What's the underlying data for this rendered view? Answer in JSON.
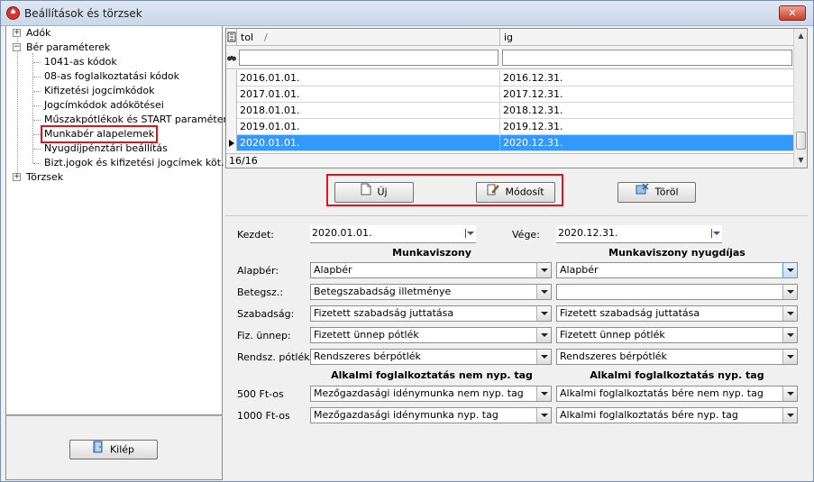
{
  "window": {
    "title": "Beállítások és törzsek",
    "close_label": "✕",
    "app_icon_glyph": "♠"
  },
  "tree": {
    "items": [
      {
        "label": "Adók",
        "toggle": "+"
      },
      {
        "label": "Bér paraméterek",
        "toggle": "−"
      },
      {
        "label": "1041-as kódok"
      },
      {
        "label": "08-as foglalkoztatási kódok"
      },
      {
        "label": "Kifizetési jogcímkódok"
      },
      {
        "label": "Jogcímkódok adókötései"
      },
      {
        "label": "Műszakpótlékok és START paraméterek"
      },
      {
        "label": "Munkabér alapelemek"
      },
      {
        "label": "Nyugdíjpénztári beállítás"
      },
      {
        "label": "Bizt.jogok és kifizetési jogcímek köt."
      },
      {
        "label": "Törzsek",
        "toggle": "+"
      }
    ]
  },
  "exit_button": {
    "label": "Kilép",
    "icon": "door-exit-icon"
  },
  "grid": {
    "columns": [
      {
        "label": "tol",
        "sort": "/"
      },
      {
        "label": "ig"
      }
    ],
    "rows": [
      {
        "tol": "2016.01.01.",
        "ig": "2016.12.31."
      },
      {
        "tol": "2017.01.01.",
        "ig": "2017.12.31."
      },
      {
        "tol": "2018.01.01.",
        "ig": "2018.12.31."
      },
      {
        "tol": "2019.01.01.",
        "ig": "2019.12.31."
      },
      {
        "tol": "2020.01.01.",
        "ig": "2020.12.31."
      }
    ],
    "selected_row": 4,
    "footer": "16/16"
  },
  "actions": {
    "new_label": "Új",
    "edit_label": "Módosít",
    "delete_label": "Töröl"
  },
  "form": {
    "start_label": "Kezdet:",
    "start_value": "2020.01.01.",
    "end_label": "Vége:",
    "end_value": "2020.12.31.",
    "col1_header": "Munkaviszony",
    "col2_header": "Munkaviszony nyugdíjas",
    "rows": [
      {
        "label": "Alapbér:",
        "v1": "Alapbér",
        "v2": "Alapbér"
      },
      {
        "label": "Betegsz.:",
        "v1": "Betegszabadság illetménye",
        "v2": ""
      },
      {
        "label": "Szabadság:",
        "v1": "Fizetett szabadság juttatása",
        "v2": "Fizetett szabadság juttatása"
      },
      {
        "label": "Fiz. ünnep:",
        "v1": "Fizetett ünnep pótlék",
        "v2": "Fizetett ünnep pótlék"
      },
      {
        "label": "Rendsz. pótlék:",
        "v1": "Rendszeres bérpótlék",
        "v2": "Rendszeres bérpótlék"
      }
    ],
    "alk_col1_header": "Alkalmi foglalkoztatás nem nyp. tag",
    "alk_col2_header": "Alkalmi foglalkoztatás nyp. tag",
    "alk_rows": [
      {
        "label": "500 Ft-os",
        "v1": "Mezőgazdasági idénymunka nem nyp. tag",
        "v2": "Alkalmi foglalkoztatás bére nem nyp. tag"
      },
      {
        "label": "1000 Ft-os",
        "v1": "Mezőgazdasági idénymunka nyp. tag",
        "v2": "Alkalmi foglalkoztatás bére nyp. tag"
      }
    ]
  },
  "colors": {
    "selection": "#3399ff",
    "highlight_box": "#e0141a"
  }
}
